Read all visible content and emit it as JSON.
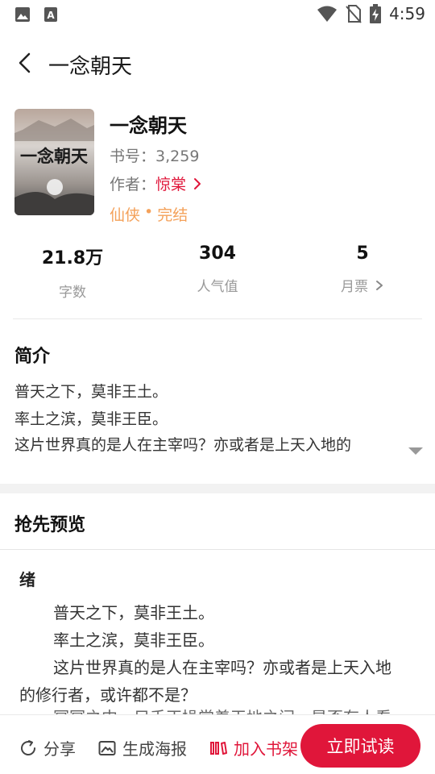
{
  "status_bar": {
    "time": "4:59",
    "icons": [
      "image-icon",
      "a-icon",
      "wifi-icon",
      "no-sim-icon",
      "battery-charging-icon"
    ]
  },
  "header": {
    "title": "一念朝天"
  },
  "book": {
    "title": "一念朝天",
    "id_label": "书号：",
    "id_value": "3,259",
    "author_label": "作者：",
    "author": "惊棠",
    "genre": "仙侠",
    "separator": "•",
    "status": "完结",
    "cover_text": "一念朝天"
  },
  "stats": [
    {
      "value": "21.8万",
      "label": "字数"
    },
    {
      "value": "304",
      "label": "人气值"
    },
    {
      "value": "5",
      "label": "月票"
    }
  ],
  "intro": {
    "title": "简介",
    "lines": [
      "普天之下，莫非王土。",
      "率土之滨，莫非王臣。",
      "这片世界真的是人在主宰吗？亦或者是上天入地的"
    ]
  },
  "preview": {
    "title": "抢先预览",
    "chapter": "绪",
    "lines": [
      "普天之下，莫非王土。",
      "率土之滨，莫非王臣。",
      "这片世界真的是人在主宰吗？亦或者是上天入地",
      "的修行者，或许都不是？",
      "冥冥之中，只手正操棠着天地之间，是否有人看"
    ]
  },
  "bottom_bar": {
    "share": "分享",
    "poster": "生成海报",
    "add_shelf": "加入书架",
    "read_now": "立即试读"
  },
  "colors": {
    "accent": "#e0163a",
    "genre": "#f4a15a",
    "section_band": "#f2f2f2"
  }
}
